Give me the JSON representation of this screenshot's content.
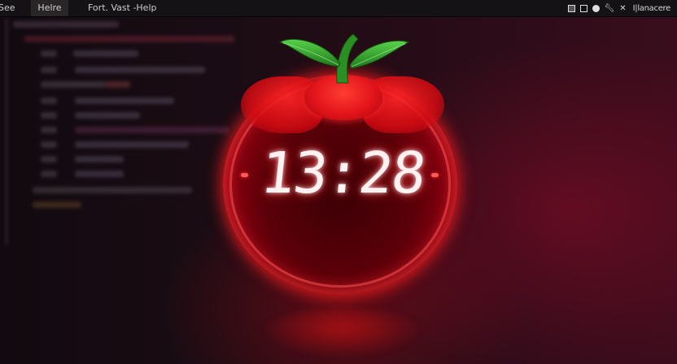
{
  "menubar": {
    "items": [
      "See",
      "Helre",
      "Fort. Vast  -Help"
    ],
    "tray_label": "I|lanacere"
  },
  "clock": {
    "time": "13:28"
  },
  "colors": {
    "tomato_red": "#ff1a1a",
    "leaf_green": "#2fa82a",
    "background": "#1b0c14"
  },
  "icons": {
    "tray": [
      "box-icon",
      "window-icon",
      "globe-icon",
      "wrench-icon",
      "close-icon"
    ]
  }
}
